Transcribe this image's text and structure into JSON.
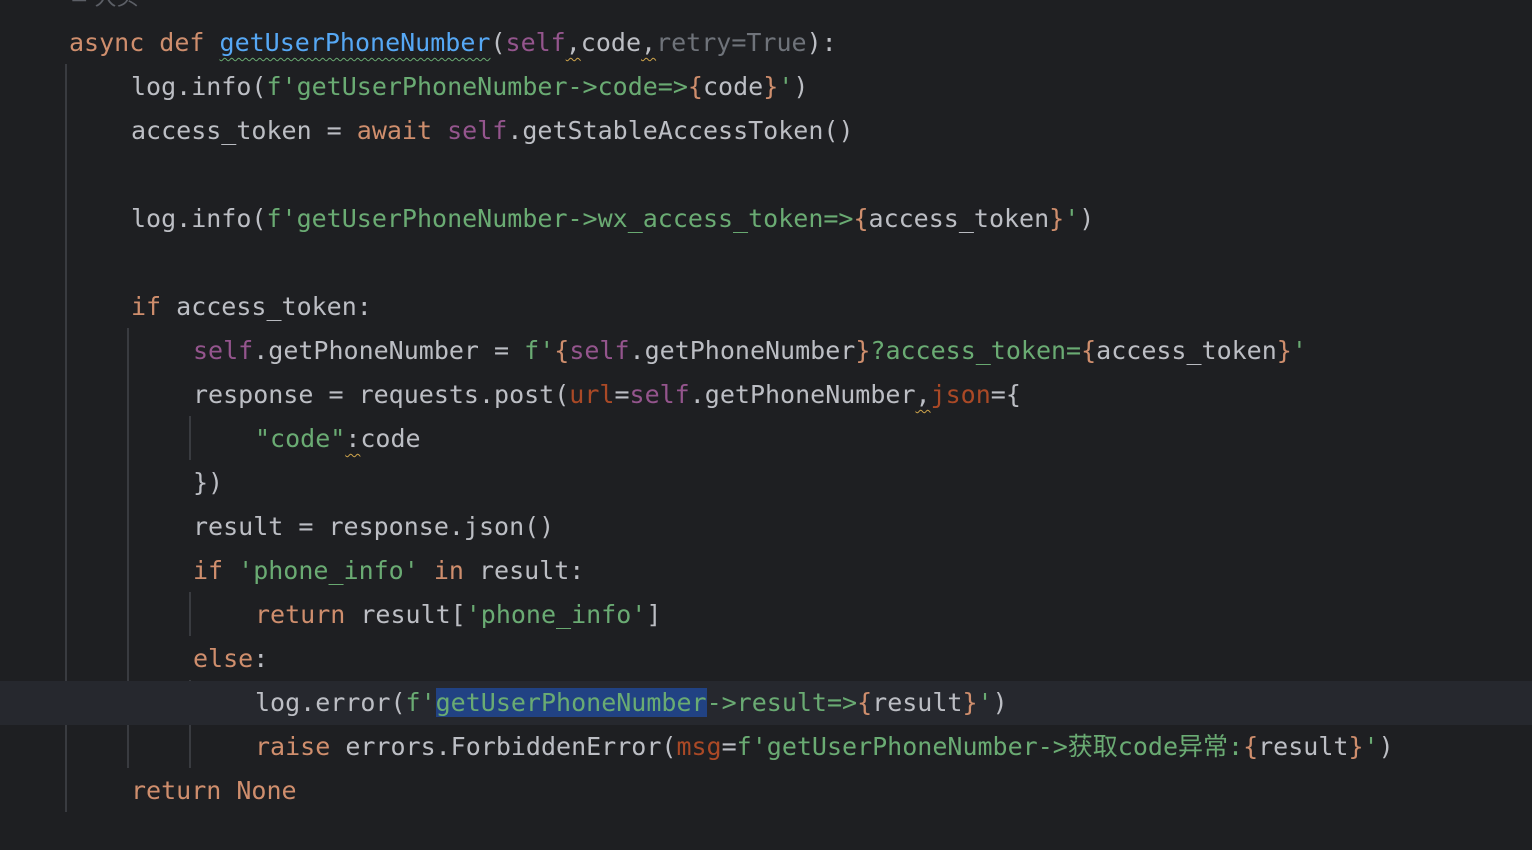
{
  "editor": {
    "author_hint": "≛ 大头",
    "lines": {
      "l1": {
        "kw": "async def ",
        "fn": "getUserPhoneNumber",
        "p1": "(",
        "self": "self",
        "c1": ",",
        "code": "code",
        "c2": ",",
        "gray": "retry=True",
        "end": "):"
      },
      "l2": {
        "a": "log.info(",
        "s1": "f'getUserPhoneNumber->code=>",
        "b1": "{",
        "v": "code",
        "b2": "}",
        "s2": "'",
        "end": ")"
      },
      "l3": {
        "a": "access_token = ",
        "kw": "await ",
        "self": "self",
        "b": ".getStableAccessToken()"
      },
      "l5": {
        "a": "log.info(",
        "s1": "f'getUserPhoneNumber->wx_access_token=>",
        "b1": "{",
        "v": "access_token",
        "b2": "}",
        "s2": "'",
        "end": ")"
      },
      "l7": {
        "kw": "if ",
        "a": "access_token:"
      },
      "l8": {
        "self": "self",
        "a": ".getPhoneNumber = ",
        "s1": "f'",
        "b1": "{",
        "self2": "self",
        "v": ".getPhoneNumber",
        "b2": "}",
        "s2": "?access_token=",
        "b3": "{",
        "v2": "access_token",
        "b4": "}",
        "s3": "'"
      },
      "l9": {
        "a": "response = requests.post(",
        "p1": "url",
        "eq": "=",
        "self": "self",
        "b": ".getPhoneNumber",
        "comma": ",",
        "p2": "json",
        "end": "={"
      },
      "l10": {
        "s": "\"code\"",
        "colon": ":",
        "a": "code"
      },
      "l11": {
        "a": "})"
      },
      "l12": {
        "a": "result = response.json()"
      },
      "l13": {
        "kw": "if ",
        "s": "'phone_info'",
        "kw2": " in ",
        "a": "result:"
      },
      "l14": {
        "kw": "return ",
        "a": "result[",
        "s": "'phone_info'",
        "end": "]"
      },
      "l15": {
        "kw": "else",
        "a": ":"
      },
      "l16": {
        "a": "log.error(",
        "s1": "f'",
        "sel": "getUserPhoneNumber",
        "s2": "->result=>",
        "b1": "{",
        "v": "result",
        "b2": "}",
        "s3": "'",
        "end": ")"
      },
      "l17": {
        "kw": "raise ",
        "a": "errors.ForbiddenError(",
        "p": "msg",
        "eq": "=",
        "s1": "f'getUserPhoneNumber->获取code异常:",
        "b1": "{",
        "v": "result",
        "b2": "}",
        "s2": "'",
        "end": ")"
      },
      "l18": {
        "kw": "return None"
      }
    }
  },
  "colors": {
    "background": "#1e1f22",
    "keyword": "#cf8e6d",
    "string": "#6aab73",
    "self": "#94558d",
    "function": "#56a8f5",
    "param": "#aa4926",
    "selection": "#214283"
  }
}
